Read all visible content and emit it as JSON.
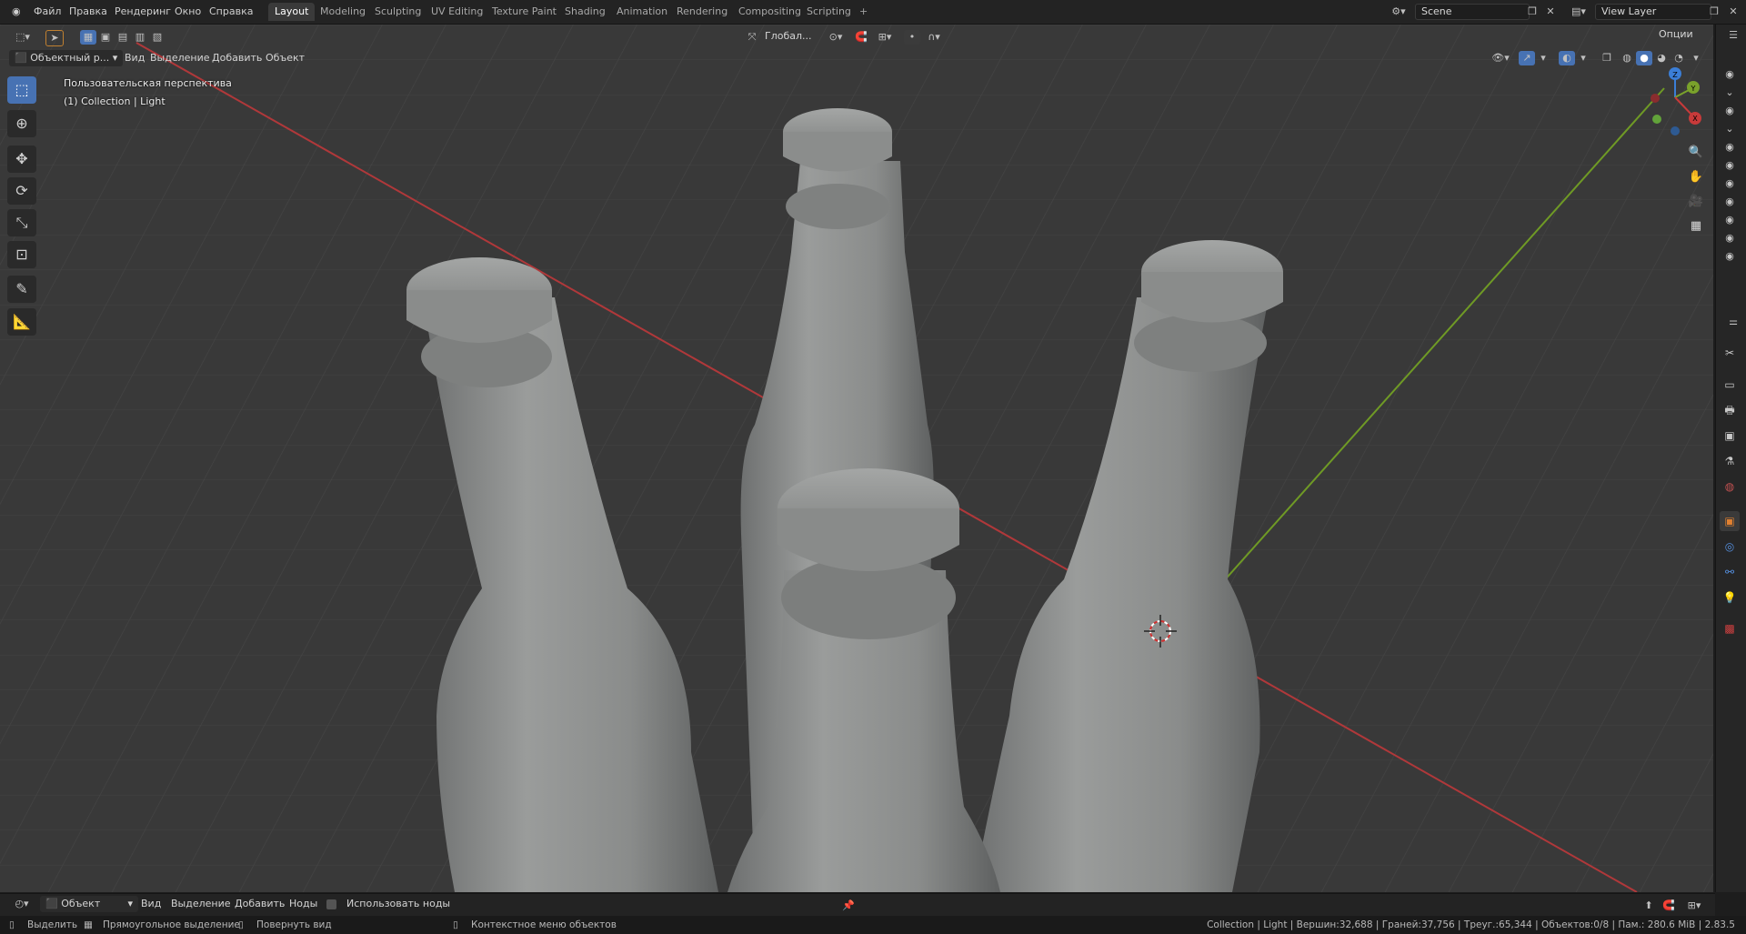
{
  "menubar": {
    "items": [
      "Файл",
      "Правка",
      "Рендеринг",
      "Окно",
      "Справка"
    ]
  },
  "workspaces": {
    "tabs": [
      "Layout",
      "Modeling",
      "Sculpting",
      "UV Editing",
      "Texture Paint",
      "Shading",
      "Animation",
      "Rendering",
      "Compositing",
      "Scripting"
    ],
    "active_index": 0,
    "add_label": "+"
  },
  "scene": {
    "name": "Scene",
    "view_layer": "View Layer"
  },
  "viewport_header": {
    "mode": "Объектный р...",
    "menus": [
      "Вид",
      "Выделение",
      "Добавить",
      "Объект"
    ],
    "orientation": "Глобал...",
    "options": "Опции"
  },
  "viewport": {
    "view_name": "Пользовательская перспектива",
    "collection_info": "(1) Collection | Light",
    "colors": {
      "x_axis": "#c83a3a",
      "y_axis": "#7aa22b",
      "z_axis": "#3b7ed6",
      "grid_bg": "#393939",
      "bottle": "#8f9190"
    },
    "gizmo": {
      "x": "X",
      "y": "Y",
      "z": "Z"
    }
  },
  "toolbar": {
    "tools": [
      "select-box-icon",
      "cursor-icon",
      "move-icon",
      "rotate-icon",
      "scale-icon",
      "transform-icon",
      "annotate-icon",
      "measure-icon"
    ]
  },
  "timeline_header": {
    "mode": "Объект",
    "menus": [
      "Вид",
      "Выделение",
      "Добавить",
      "Ноды"
    ],
    "use_nodes_label": "Использовать ноды"
  },
  "status": {
    "select": "Выделить",
    "box_select": "Прямоугольное выделение",
    "rotate_view": "Повернуть вид",
    "context_menu": "Контекстное меню объектов",
    "stats": "Collection | Light | Вершин:32,688 | Граней:37,756 | Треуг.:65,344 | Объектов:0/8 | Пам.: 280.6 MiB | 2.83.5"
  }
}
